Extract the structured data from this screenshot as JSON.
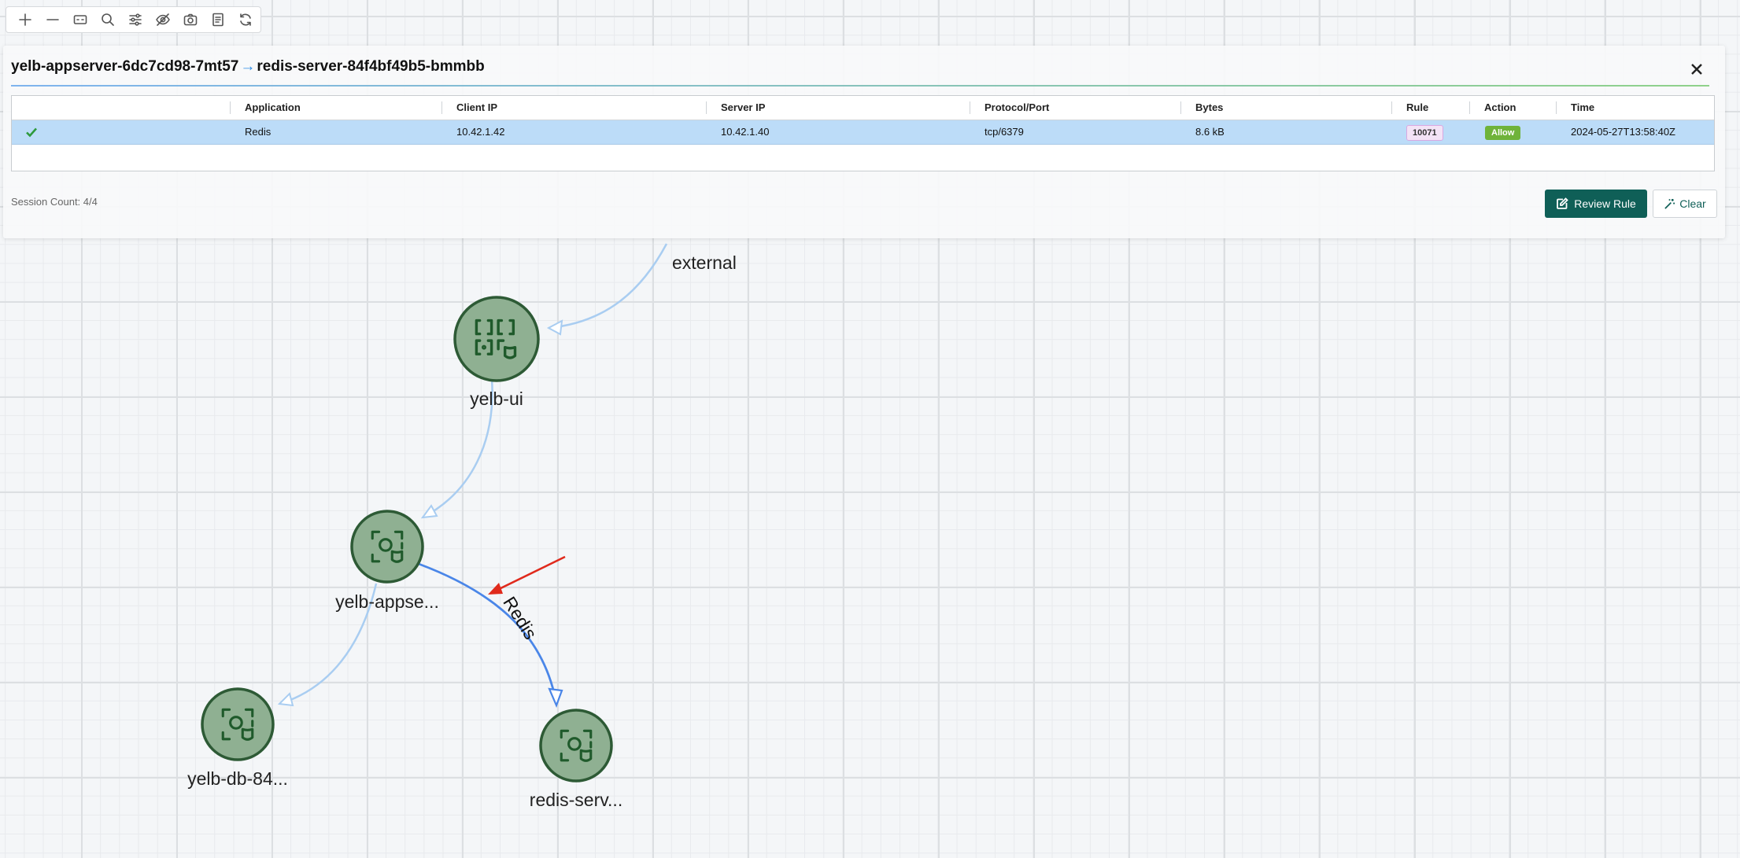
{
  "toolbar": {
    "buttons": [
      {
        "name": "zoom-in-icon"
      },
      {
        "name": "zoom-out-icon"
      },
      {
        "name": "fit-view-icon"
      },
      {
        "name": "search-icon"
      },
      {
        "name": "filter-sliders-icon"
      },
      {
        "name": "hide-eye-icon"
      },
      {
        "name": "camera-icon"
      },
      {
        "name": "report-icon"
      },
      {
        "name": "refresh-icon"
      }
    ]
  },
  "panel": {
    "source": "yelb-appserver-6dc7cd98-7mt57",
    "arrow": "→",
    "destination": "redis-server-84f4bf49b5-bmmbb",
    "columns": {
      "application": "Application",
      "client_ip": "Client IP",
      "server_ip": "Server IP",
      "protocol_port": "Protocol/Port",
      "bytes": "Bytes",
      "rule": "Rule",
      "action": "Action",
      "time": "Time"
    },
    "rows": [
      {
        "status": "check-icon",
        "application": "Redis",
        "client_ip": "10.42.1.42",
        "server_ip": "10.42.1.40",
        "protocol_port": "tcp/6379",
        "bytes": "8.6 kB",
        "rule": "10071",
        "action": "Allow",
        "time": "2024-05-27T13:58:40Z"
      }
    ],
    "session_count": "Session Count: 4/4",
    "review_rule_label": "Review Rule",
    "clear_label": "Clear"
  },
  "graph": {
    "nodes": [
      {
        "id": "external",
        "label": "external"
      },
      {
        "id": "yelb-ui",
        "label": "yelb-ui",
        "icon": "service-group-icon"
      },
      {
        "id": "yelb-appserver",
        "label": "yelb-appse...",
        "icon": "workload-icon"
      },
      {
        "id": "yelb-db",
        "label": "yelb-db-84...",
        "icon": "workload-icon"
      },
      {
        "id": "redis-server",
        "label": "redis-serv...",
        "icon": "workload-icon"
      }
    ],
    "edges": [
      {
        "from": "external",
        "to": "yelb-ui",
        "label": ""
      },
      {
        "from": "yelb-ui",
        "to": "yelb-appserver",
        "label": ""
      },
      {
        "from": "yelb-appserver",
        "to": "yelb-db",
        "label": ""
      },
      {
        "from": "yelb-appserver",
        "to": "redis-server",
        "label": "Redis",
        "highlighted": true
      }
    ],
    "colors": {
      "node_fill": "#8fb092",
      "node_stroke": "#2d5a35",
      "icon": "#1f5a2b",
      "edge": "#a9cdf1",
      "edge_highlight": "#4a86e8",
      "annotation_arrow": "#e02a1c"
    }
  }
}
